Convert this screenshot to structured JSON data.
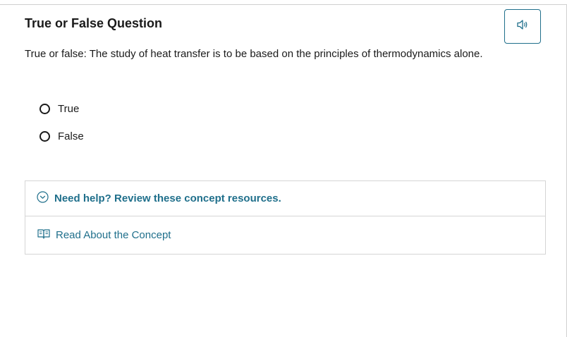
{
  "question": {
    "heading": "True or False Question",
    "prompt": "True or false: The study of heat transfer is to be based on the principles of thermodynamics alone.",
    "options": [
      {
        "label": "True"
      },
      {
        "label": "False"
      }
    ]
  },
  "help": {
    "toggle_label": "Need help? Review these concept resources.",
    "resource_label": "Read About the Concept"
  },
  "icons": {
    "audio": "speaker-icon",
    "expand": "chevron-down-circle-icon",
    "resource": "book-icon"
  },
  "colors": {
    "accent": "#1f6f8b",
    "text": "#1a1a1a",
    "border": "#d5d5d5"
  }
}
